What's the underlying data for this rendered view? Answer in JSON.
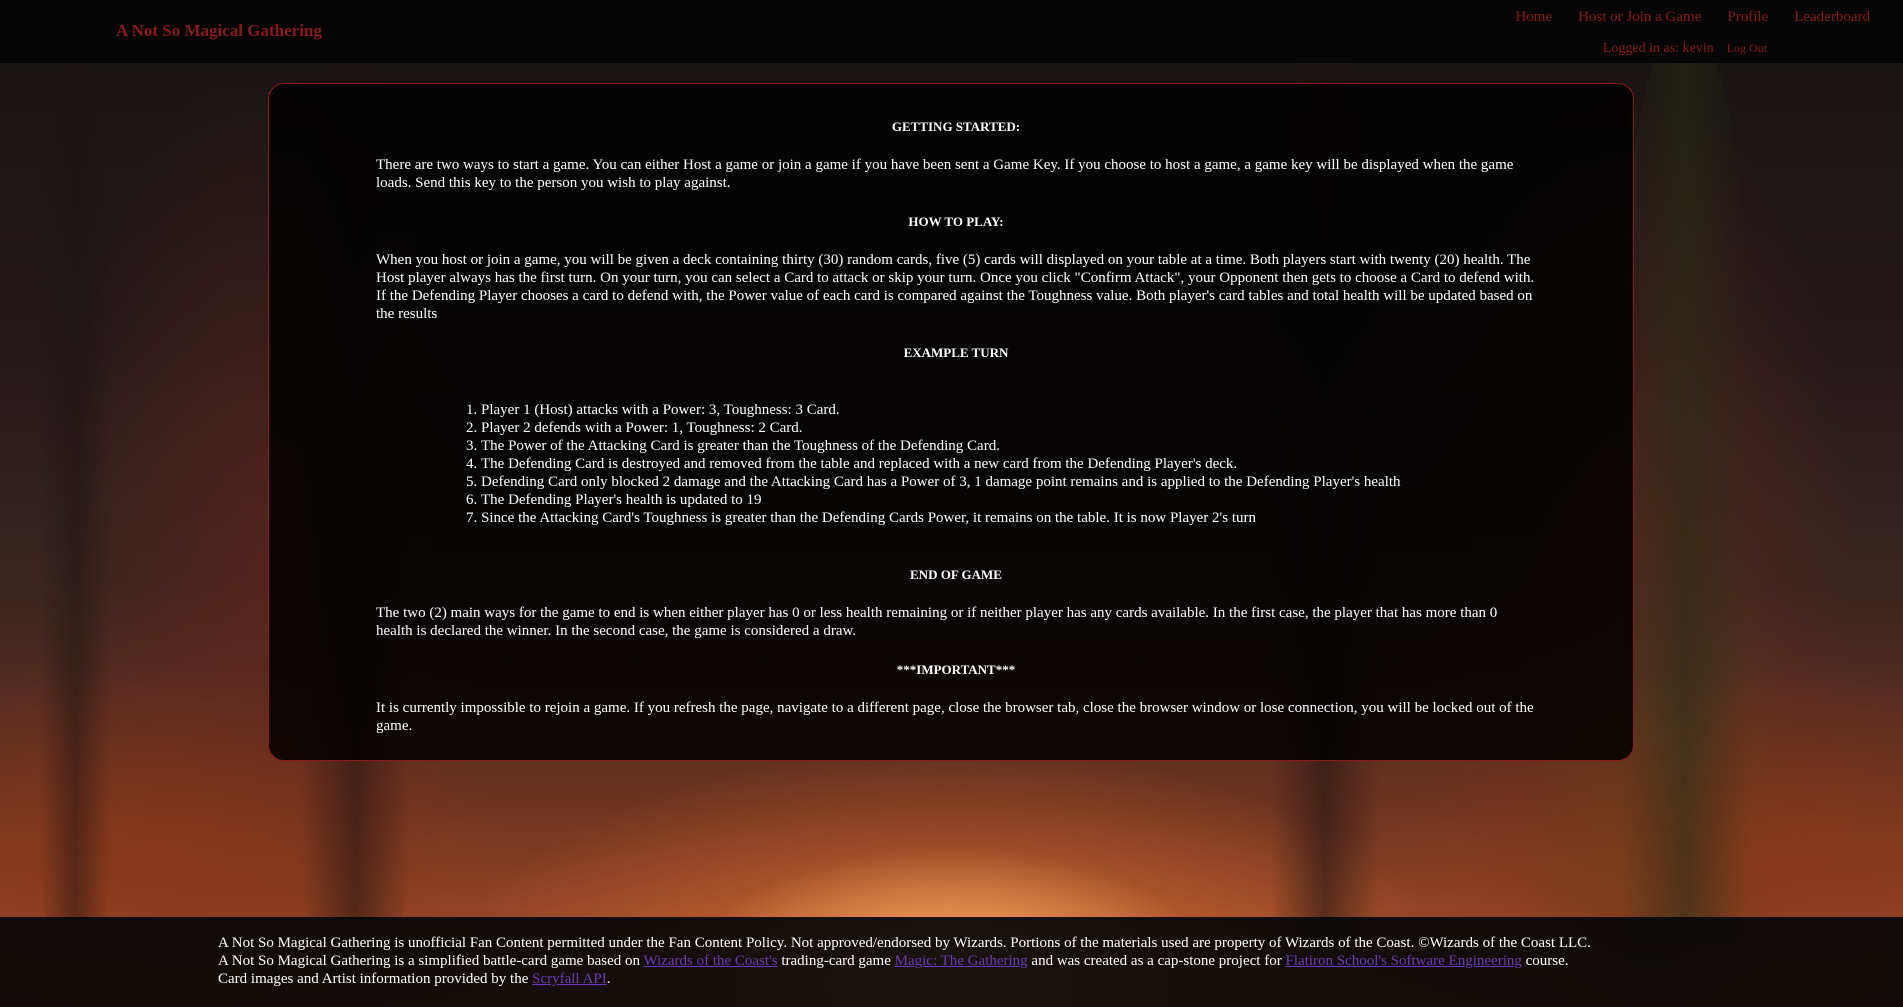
{
  "header": {
    "brand": "A Not So Magical Gathering",
    "nav": {
      "home": "Home",
      "host_join": "Host or Join a Game",
      "profile": "Profile",
      "leaderboard": "Leaderboard"
    },
    "logged_in": "Logged in as: kevin",
    "logout": "Log Out"
  },
  "rules": {
    "getting_started_title": "GETTING STARTED:",
    "getting_started_text": "There are two ways to start a game. You can either Host a game or join a game if you have been sent a Game Key. If you choose to host a game, a game key will be displayed when the game loads. Send this key to the person you wish to play against.",
    "how_to_play_title": "HOW TO PLAY:",
    "how_to_play_text": "When you host or join a game, you will be given a deck containing thirty (30) random cards, five (5) cards will displayed on your table at a time. Both players start with twenty (20) health. The Host player always has the first turn. On your turn, you can select a Card to attack or skip your turn. Once you click \"Confirm Attack\", your Opponent then gets to choose a Card to defend with. If the Defending Player chooses a card to defend with, the Power value of each card is compared against the Toughness value. Both player's card tables and total health will be updated based on the results",
    "example_title": "EXAMPLE TURN",
    "example_steps": [
      "Player 1 (Host) attacks with a Power: 3, Toughness: 3 Card.",
      "Player 2 defends with a Power: 1, Toughness: 2 Card.",
      "The Power of the Attacking Card is greater than the Toughness of the Defending Card.",
      "The Defending Card is destroyed and removed from the table and replaced with a new card from the Defending Player's deck.",
      "Defending Card only blocked 2 damage and the Attacking Card has a Power of 3, 1 damage point remains and is applied to the Defending Player's health",
      "The Defending Player's health is updated to 19",
      "Since the Attacking Card's Toughness is greater than the Defending Cards Power, it remains on the table. It is now Player 2's turn"
    ],
    "end_title": "END OF GAME",
    "end_text": "The two (2) main ways for the game to end is when either player has 0 or less health remaining or if neither player has any cards available. In the first case, the player that has more than 0 health is declared the winner. In the second case, the game is considered a draw.",
    "important_title": "***IMPORTANT***",
    "important_text": "It is currently impossible to rejoin a game. If you refresh the page, navigate to a different page, close the browser tab, close the browser window or lose connection, you will be locked out of the game."
  },
  "footer": {
    "line1": "A Not So Magical Gathering is unofficial Fan Content permitted under the Fan Content Policy. Not approved/endorsed by Wizards. Portions of the materials used are property of Wizards of the Coast. ©Wizards of the Coast LLC.",
    "line2_a": "A Not So Magical Gathering is a simplified battle-card game based on ",
    "line2_link1": "Wizards of the Coast's",
    "line2_b": " trading-card game ",
    "line2_link2": "Magic: The Gathering",
    "line2_c": " and was created as a cap-stone project for ",
    "line2_link3": "Flatiron School's Software Engineering",
    "line2_d": " course.",
    "line3_a": "Card images and Artist information provided by the ",
    "line3_link": "Scryfall API",
    "line3_b": "."
  },
  "colors": {
    "brand_red": "#8b1a1a",
    "link_purple": "#6a3bb7",
    "panel_bg": "#000000"
  }
}
